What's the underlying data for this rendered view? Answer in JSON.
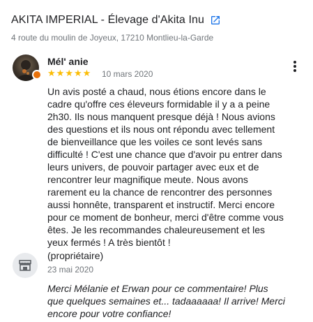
{
  "business": {
    "title": "AKITA IMPERIAL - Élevage d'Akita Inu",
    "address": "4 route du moulin de Joyeux, 17210 Montlieu-la-Garde",
    "external_link_icon": "open-in-new-icon"
  },
  "review": {
    "reviewer_name": "Mél' anie",
    "rating": 5,
    "rating_max": 5,
    "date": "10 mars 2020",
    "text": "Un avis posté a chaud, nous étions encore dans le cadre qu'offre ces éleveurs formidable il y a a peine 2h30. Ils nous manquent presque déjà ! Nous avions des questions et ils nous ont répondu avec tellement de bienveillance que les voiles ce sont levés sans difficulté ! C'est une chance que d'avoir pu entrer dans leurs univers, de pouvoir partager avec eux et de rencontrer leur magnifique meute. Nous avons rarement eu la chance de rencontrer des personnes aussi honnête, transparent et instructif. Merci encore pour ce moment de bonheur, merci d'être comme vous êtes. Je les recommandes chaleureusement et les yeux fermés ! A très bientôt !",
    "star_color": "#fbbc04",
    "menu_icon": "more-vert-icon",
    "avatar_icon": "user-avatar-photo",
    "badge_color": "#e8710a"
  },
  "owner_response": {
    "label": "(propriétaire)",
    "date": "23 mai 2020",
    "text": "Merci Mélanie et Erwan pour ce commentaire! Plus que quelques semaines et... tadaaaaaa! Il arrive! Merci encore pour votre confiance!",
    "avatar_icon": "storefront-icon"
  }
}
